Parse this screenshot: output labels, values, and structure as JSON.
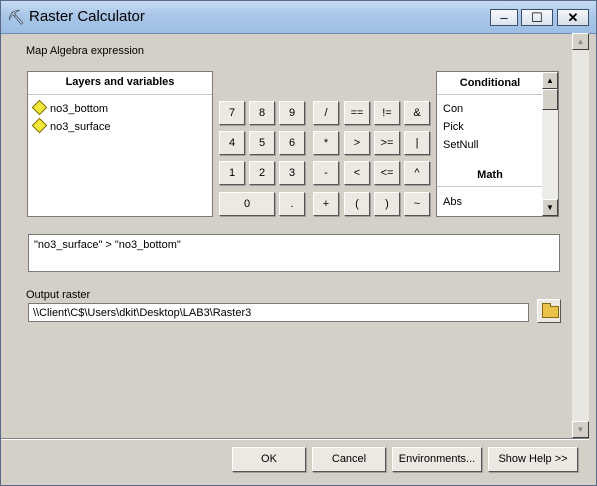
{
  "window": {
    "title": "Raster Calculator",
    "min": "–",
    "max": "☐",
    "close": "✕"
  },
  "map_algebra_label": "Map Algebra expression",
  "layers": {
    "header": "Layers and variables",
    "items": [
      "no3_bottom",
      "no3_surface"
    ]
  },
  "calculator": {
    "row1": [
      "7",
      "8",
      "9",
      "/",
      "==",
      "!=",
      "&"
    ],
    "row2": [
      "4",
      "5",
      "6",
      "*",
      ">",
      ">=",
      "|"
    ],
    "row3": [
      "1",
      "2",
      "3",
      "-",
      "<",
      "<=",
      "^"
    ],
    "row4": [
      "0",
      ".",
      "+",
      "(",
      ")",
      "~"
    ]
  },
  "functions": {
    "conditional_header": "Conditional",
    "conditional": [
      "Con",
      "Pick",
      "SetNull"
    ],
    "math_header": "Math",
    "math": [
      "Abs"
    ]
  },
  "expression": "\"no3_surface\" > \"no3_bottom\"",
  "output_label": "Output raster",
  "output_path": "\\\\Client\\C$\\Users\\dkit\\Desktop\\LAB3\\Raster3",
  "buttons": {
    "ok": "OK",
    "cancel": "Cancel",
    "environments": "Environments...",
    "show_help": "Show Help >>"
  }
}
